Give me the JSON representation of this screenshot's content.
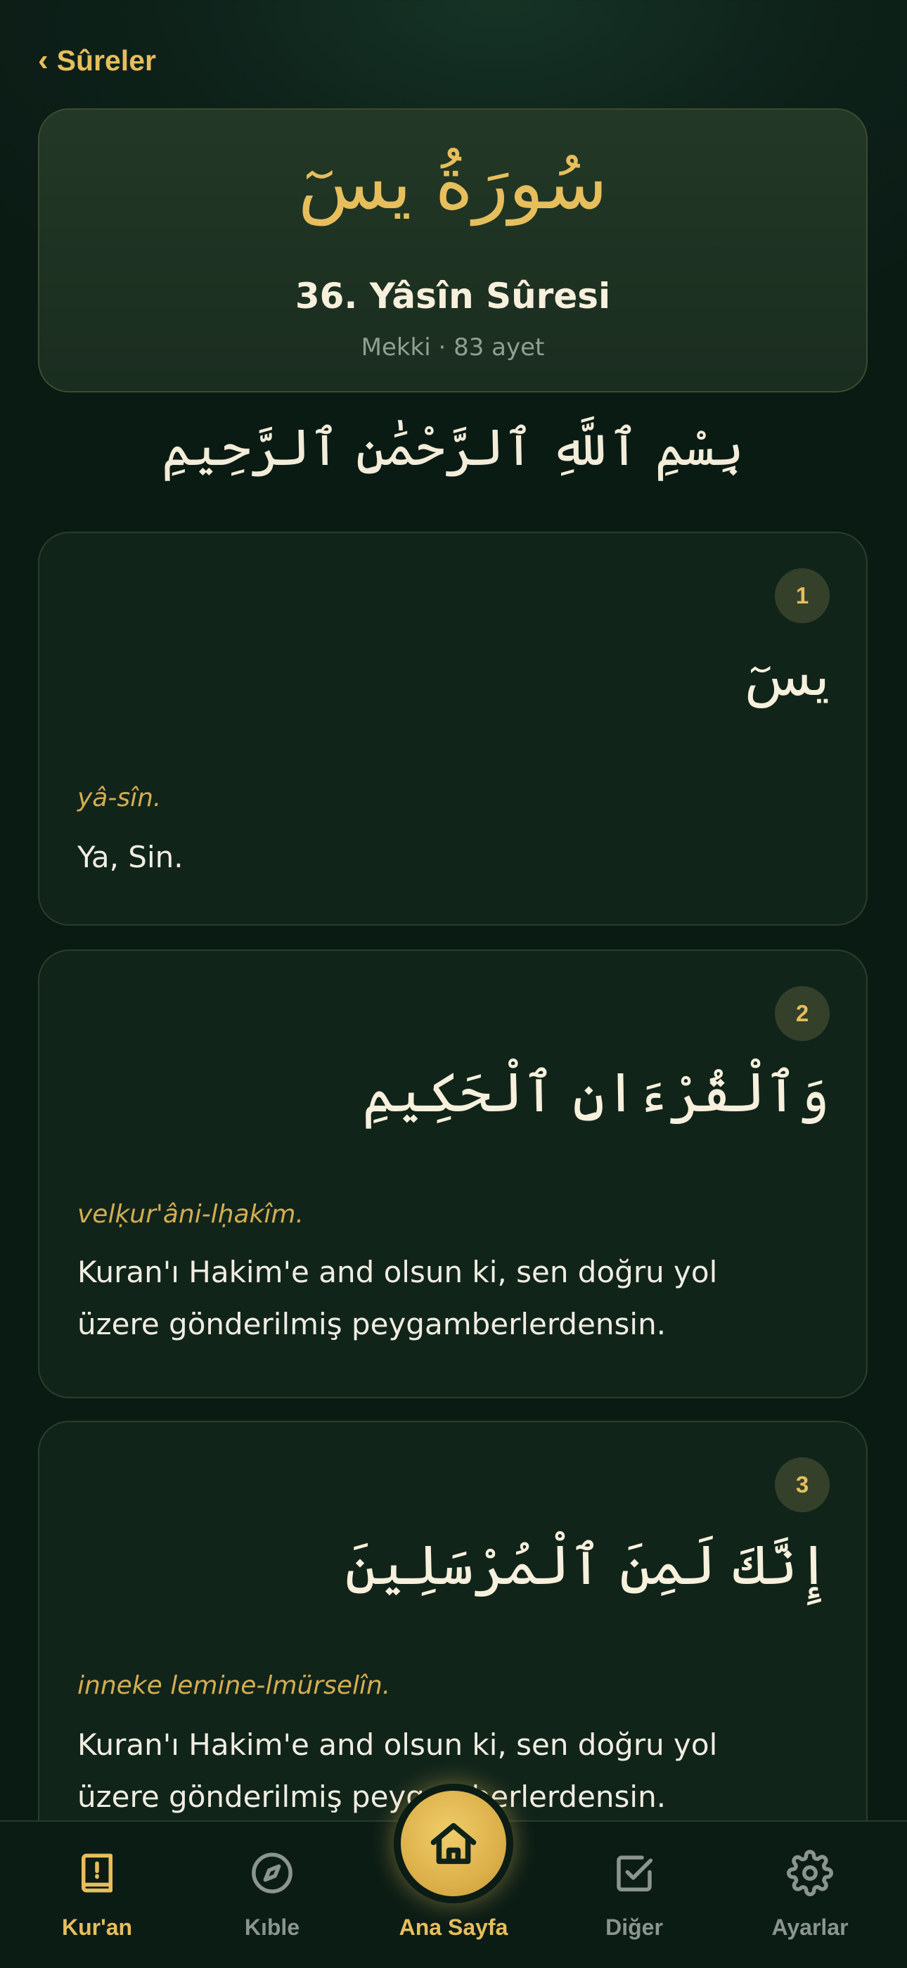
{
  "nav": {
    "back_label": "Sûreler"
  },
  "surah": {
    "arabic_name": "سُورَةُ يسٓ",
    "title": "36. Yâsîn Sûresi",
    "meta": "Mekki · 83 ayet"
  },
  "basmala": "بِسْمِ ٱللَّهِ ٱلرَّحْمَٰنِ ٱلرَّحِيمِ",
  "ayahs": [
    {
      "number": "1",
      "arabic": "يسٓ",
      "transliteration": "yâ-sîn.",
      "translation": "Ya, Sin."
    },
    {
      "number": "2",
      "arabic": "وَٱلْقُرْءَانِ ٱلْحَكِيمِ",
      "transliteration": "velḳur'âni-lḥakîm.",
      "translation": "Kuran'ı Hakim'e and olsun ki, sen doğru yol üzere gönderilmiş peygamberlerdensin."
    },
    {
      "number": "3",
      "arabic": "إِنَّكَ لَمِنَ ٱلْمُرْسَلِينَ",
      "transliteration": "inneke lemine-lmürselîn.",
      "translation": "Kuran'ı Hakim'e and olsun ki, sen doğru yol üzere gönderilmiş peygamberlerdensin."
    }
  ],
  "tabs": {
    "quran": "Kur'an",
    "qibla": "Kıble",
    "home": "Ana Sayfa",
    "other": "Diğer",
    "settings": "Ayarlar"
  },
  "colors": {
    "accent": "#e6be5c",
    "background": "#0d2119",
    "card": "#11241a",
    "inactive": "#8a958d"
  },
  "icons": {
    "back": "chevron-left-icon",
    "quran": "book-icon",
    "qibla": "compass-icon",
    "home": "home-icon",
    "other": "checkbox-icon",
    "settings": "gear-icon"
  }
}
